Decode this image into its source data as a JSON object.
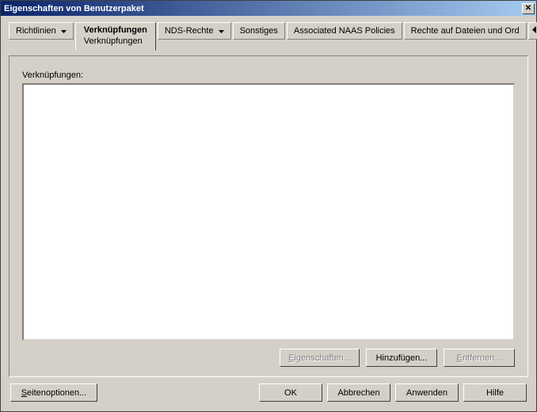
{
  "window": {
    "title": "Eigenschaften von Benutzerpaket"
  },
  "tabs": {
    "richtlinien": "Richtlinien",
    "verknuepfungen": "Verknüpfungen",
    "verknuepfungen_sub": "Verknüpfungen",
    "nds_rechte": "NDS-Rechte",
    "sonstiges": "Sonstiges",
    "naas": "Associated NAAS Policies",
    "rechte_dateien": "Rechte auf Dateien und Ord"
  },
  "panel": {
    "list_label": "Verknüpfungen:",
    "eigenschaften": "Eigenschaften...",
    "hinzufuegen": "Hinzufügen...",
    "entfernen": "Entfernen..."
  },
  "buttons": {
    "seitenoptionen": "Seitenoptionen...",
    "ok": "OK",
    "abbrechen": "Abbrechen",
    "anwenden": "Anwenden",
    "hilfe": "Hilfe"
  }
}
